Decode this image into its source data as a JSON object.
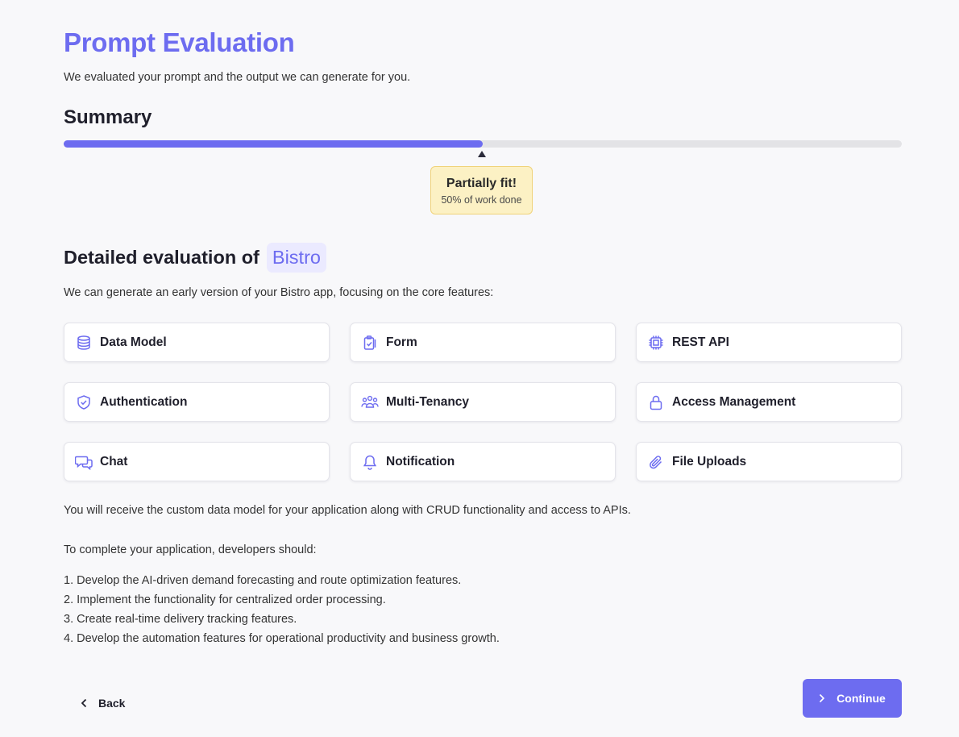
{
  "header": {
    "title": "Prompt Evaluation",
    "subtitle": "We evaluated your prompt and the output we can generate for you."
  },
  "summary": {
    "heading": "Summary",
    "progress_percent": 50,
    "badge_title": "Partially fit!",
    "badge_subtitle": "50% of work done"
  },
  "detail": {
    "heading": "Detailed evaluation of",
    "app_name": "Bistro",
    "description": "We can generate an early version of your Bistro app, focusing on the core features:"
  },
  "features": [
    {
      "label": "Data Model",
      "icon": "database-icon"
    },
    {
      "label": "Form",
      "icon": "clipboard-check-icon"
    },
    {
      "label": "REST API",
      "icon": "chip-icon"
    },
    {
      "label": "Authentication",
      "icon": "shield-check-icon"
    },
    {
      "label": "Multi-Tenancy",
      "icon": "users-group-icon"
    },
    {
      "label": "Access Management",
      "icon": "lock-icon"
    },
    {
      "label": "Chat",
      "icon": "chat-bubbles-icon"
    },
    {
      "label": "Notification",
      "icon": "bell-icon"
    },
    {
      "label": "File Uploads",
      "icon": "paperclip-icon"
    }
  ],
  "info": {
    "receive_text": "You will receive the custom data model for your application along with CRUD functionality and access to APIs.",
    "complete_text": "To complete your application, developers should:",
    "steps": [
      "1. Develop the AI-driven demand forecasting and route optimization features.",
      "2. Implement the functionality for centralized order processing.",
      "3. Create real-time delivery tracking features.",
      "4. Develop the automation features for operational productivity and business growth."
    ]
  },
  "footer": {
    "back_label": "Back",
    "continue_label": "Continue"
  },
  "colors": {
    "accent": "#6d6cf0",
    "badge_bg": "#fcf1c4",
    "badge_border": "#f0d37a"
  }
}
